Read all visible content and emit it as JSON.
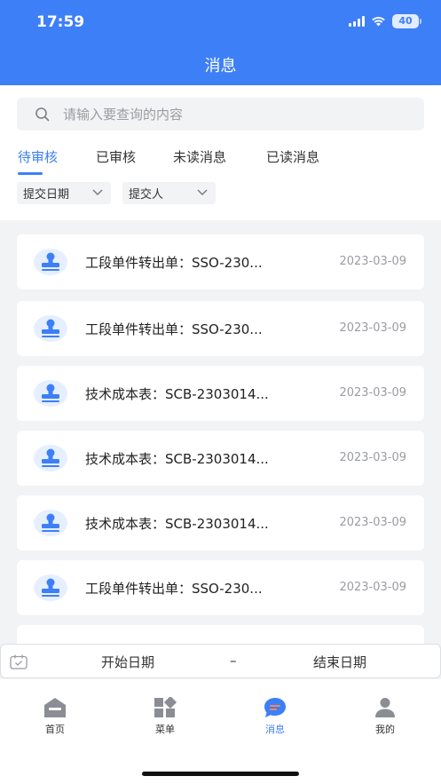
{
  "status_bar": {
    "time": "17:59",
    "battery": "40"
  },
  "header": {
    "title": "消息"
  },
  "search": {
    "placeholder": "请输入要查询的内容"
  },
  "tabs": [
    {
      "label": "待审核",
      "active": true
    },
    {
      "label": "已审核",
      "active": false
    },
    {
      "label": "未读消息",
      "active": false
    },
    {
      "label": "已读消息",
      "active": false
    }
  ],
  "filters": [
    {
      "label": "提交日期"
    },
    {
      "label": "提交人"
    }
  ],
  "messages": [
    {
      "title": "工段单件转出单：SSO-230...",
      "date": "2023-03-09"
    },
    {
      "title": "工段单件转出单：SSO-230...",
      "date": "2023-03-09"
    },
    {
      "title": "技术成本表：SCB-2303014...",
      "date": "2023-03-09"
    },
    {
      "title": "技术成本表：SCB-2303014...",
      "date": "2023-03-09"
    },
    {
      "title": "技术成本表：SCB-2303014...",
      "date": "2023-03-09"
    },
    {
      "title": "工段单件转出单：SSO-230...",
      "date": "2023-03-09"
    }
  ],
  "date_range": {
    "start": "开始日期",
    "separator": "–",
    "end": "结束日期"
  },
  "tabbar": [
    {
      "label": "首页",
      "icon": "home-icon",
      "active": false
    },
    {
      "label": "菜单",
      "icon": "menu-grid-icon",
      "active": false
    },
    {
      "label": "消息",
      "icon": "message-icon",
      "active": true
    },
    {
      "label": "我的",
      "icon": "user-icon",
      "active": false
    }
  ],
  "colors": {
    "primary": "#3d7ff6",
    "background": "#f2f3f5",
    "muted": "#9a9ca2"
  }
}
